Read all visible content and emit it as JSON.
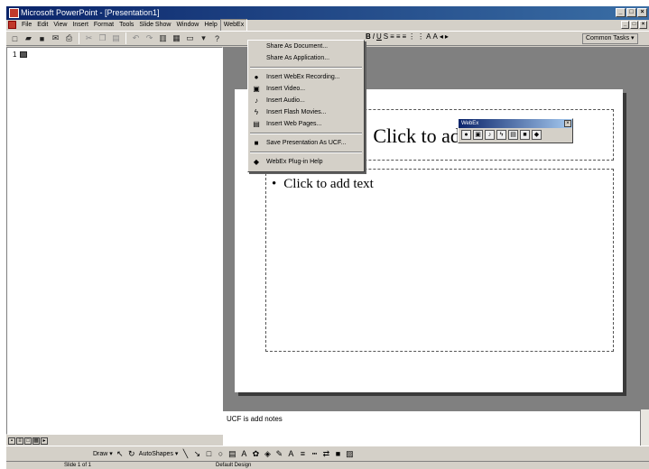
{
  "window": {
    "title": "Microsoft PowerPoint - [Presentation1]",
    "controls": [
      "_",
      "□",
      "×"
    ],
    "doc_controls": [
      "_",
      "□",
      "×"
    ]
  },
  "menubar": {
    "items": [
      "File",
      "Edit",
      "View",
      "Insert",
      "Format",
      "Tools",
      "Slide Show",
      "Window",
      "Help",
      "WebEx"
    ],
    "open_item": "WebEx"
  },
  "toolbar": {
    "common_tasks": "Common Tasks ▾"
  },
  "webex_menu": {
    "items": [
      {
        "label": "Share As Document...",
        "icon": ""
      },
      {
        "label": "Share As Application...",
        "icon": ""
      },
      {
        "divider": true
      },
      {
        "label": "Insert WebEx Recording...",
        "icon": "recording-icon"
      },
      {
        "label": "Insert Video...",
        "icon": "video-icon"
      },
      {
        "label": "Insert Audio...",
        "icon": "audio-icon"
      },
      {
        "label": "Insert Flash Movies...",
        "icon": "flash-icon"
      },
      {
        "label": "Insert Web Pages...",
        "icon": "web-page-icon"
      },
      {
        "divider": true
      },
      {
        "label": "Save Presentation As UCF...",
        "icon": "save-icon"
      },
      {
        "divider": true
      },
      {
        "label": "WebEx Plug-in Help",
        "icon": "help-icon"
      }
    ]
  },
  "outline": {
    "slide_number": "1"
  },
  "slide": {
    "title_placeholder": "Click to add title",
    "body_placeholder": "Click to add text"
  },
  "webex_toolbar": {
    "title": "WebEx"
  },
  "notes": {
    "text": "UCF is add notes"
  },
  "drawbar": {
    "draw": "Draw ▾",
    "autoshapes": "AutoShapes ▾"
  },
  "statusbar": {
    "slide": "Slide 1 of 1",
    "design": "Default Design"
  }
}
